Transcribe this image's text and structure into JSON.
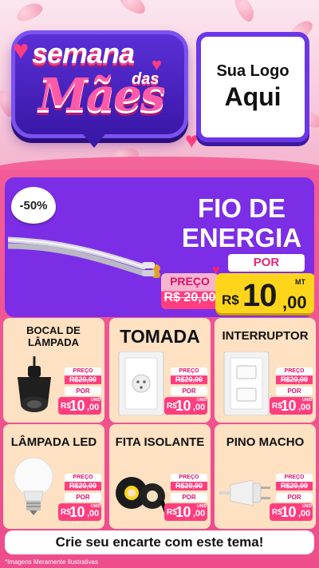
{
  "header": {
    "title_line1": "semana",
    "title_line2": "das",
    "title_line3": "Mães",
    "logo_line1": "Sua Logo",
    "logo_line2": "Aqui"
  },
  "featured": {
    "discount_badge": "-50%",
    "title_line1": "FIO DE",
    "title_line2": "ENERGIA",
    "por_label": "POR",
    "preco_label": "PREÇO",
    "old_price": "R$ 20,00",
    "currency": "R$",
    "price_main": "10",
    "price_cents": ",00",
    "unit": "MT",
    "icon": "electric-cable-image"
  },
  "products": [
    {
      "name": "BOCAL DE LÂMPADA",
      "icon": "lamp-socket-image",
      "preco_label": "PREÇO",
      "old_price": "R$20,00",
      "por_label": "POR",
      "currency": "R$",
      "price_main": "10",
      "price_cents": ",00",
      "unit": "UNID"
    },
    {
      "name": "TOMADA",
      "icon": "wall-outlet-image",
      "preco_label": "PREÇO",
      "old_price": "R$20,00",
      "por_label": "POR",
      "currency": "R$",
      "price_main": "10",
      "price_cents": ",00",
      "unit": "UNID"
    },
    {
      "name": "INTERRUPTOR",
      "icon": "light-switch-image",
      "preco_label": "PREÇO",
      "old_price": "R$20,00",
      "por_label": "POR",
      "currency": "R$",
      "price_main": "10",
      "price_cents": ",00",
      "unit": "UNID"
    },
    {
      "name": "LÂMPADA LED",
      "icon": "led-bulb-image",
      "preco_label": "PREÇO",
      "old_price": "R$20,00",
      "por_label": "POR",
      "currency": "R$",
      "price_main": "10",
      "price_cents": ",00",
      "unit": "UNID"
    },
    {
      "name": "FITA ISOLANTE",
      "icon": "insulating-tape-image",
      "preco_label": "PREÇO",
      "old_price": "R$20,00",
      "por_label": "POR",
      "currency": "R$",
      "price_main": "10",
      "price_cents": ",00",
      "unit": "UNID"
    },
    {
      "name": "PINO MACHO",
      "icon": "male-plug-image",
      "preco_label": "PREÇO",
      "old_price": "R$20,00",
      "por_label": "POR",
      "currency": "R$",
      "price_main": "10",
      "price_cents": ",00",
      "unit": "UNID"
    }
  ],
  "footer": {
    "cta": "Crie seu encarte com este tema!",
    "disclaimer": "*Imagens Meramente Ilustrativas"
  },
  "colors": {
    "primary_pink": "#ee4d8c",
    "purple": "#7b2ee6",
    "card_peach": "#fee1c2",
    "price_yellow": "#ffd51c",
    "price_pink": "#ff3e7f"
  }
}
